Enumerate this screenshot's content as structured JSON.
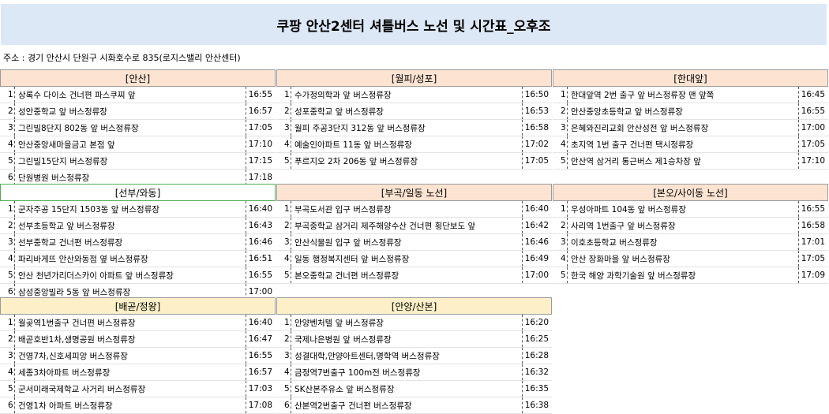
{
  "title": "쿠팡 안산2센터 셔틀버스 노선 및 시간표_오후조",
  "address": "주소 : 경기 안산시 단원구 시화호수로 835(로지스밸리 안산센터)",
  "routes": [
    {
      "name": "[안산]",
      "stops": [
        {
          "no": "1",
          "stop": "상록수 다이소 건너편 파스쿠찌 앞",
          "time": "16:55"
        },
        {
          "no": "2",
          "stop": "성안중학교 앞 버스정류장",
          "time": "16:57"
        },
        {
          "no": "3",
          "stop": "그린빌8단지 802동 앞 버스정류장",
          "time": "17:05"
        },
        {
          "no": "4",
          "stop": "안산중앙새마을금고 본점 앞",
          "time": "17:10"
        },
        {
          "no": "5",
          "stop": "그린빌15단지 버스정류장",
          "time": "17:15"
        },
        {
          "no": "6",
          "stop": "단원병원 버스정류장",
          "time": "17:18"
        }
      ]
    },
    {
      "name": "[월피/성포]",
      "stops": [
        {
          "no": "1",
          "stop": "수가정의학과 앞 버스정류장",
          "time": "16:50"
        },
        {
          "no": "2",
          "stop": "성포중학교 앞 버스정류장",
          "time": "16:53"
        },
        {
          "no": "3",
          "stop": "월피 주공3단지 312동 앞 버스정류장",
          "time": "16:58"
        },
        {
          "no": "4",
          "stop": "예술인아파트 11동 앞 버스정류장",
          "time": "17:02"
        },
        {
          "no": "5",
          "stop": "푸르지오 2차 206동 앞 버스정류장",
          "time": "17:05"
        }
      ]
    },
    {
      "name": "[한대앞]",
      "stops": [
        {
          "no": "1",
          "stop": "한대앞역 2번 출구 앞 버스정류장 맨 앞쪽",
          "time": "16:45"
        },
        {
          "no": "2",
          "stop": "안산중앙초등학교 앞 버스정류장",
          "time": "16:55"
        },
        {
          "no": "3",
          "stop": "은혜와진리교회 안산성전 앞 버스정류장",
          "time": "17:00"
        },
        {
          "no": "4",
          "stop": "초지역 1번 출구 건너편 택시정류장",
          "time": "17:05"
        },
        {
          "no": "5",
          "stop": "안산역 삼거리 통근버스 제1승차장 앞",
          "time": "17:10"
        }
      ]
    },
    {
      "name": "[선부/와동]",
      "stops": [
        {
          "no": "1",
          "stop": "군자주공 15단지 1503동 앞 버스정류장",
          "time": "16:40"
        },
        {
          "no": "2",
          "stop": "선부초등학교 앞 버스정류장",
          "time": "16:43"
        },
        {
          "no": "3",
          "stop": "선부중학교 건너편 버스정류장",
          "time": "16:46"
        },
        {
          "no": "4",
          "stop": "파리바게뜨 안산와동점 옆 버스정류장",
          "time": "16:51"
        },
        {
          "no": "5",
          "stop": "안산 천년가리더스카이 아파트 앞 버스정류장",
          "time": "16:55"
        },
        {
          "no": "6",
          "stop": "삼성중앙빌라 5동 앞 버스정류장",
          "time": "17:00"
        }
      ]
    },
    {
      "name": "[부곡/일동 노선]",
      "stops": [
        {
          "no": "1",
          "stop": "부곡도서관 입구 버스정류장",
          "time": "16:40"
        },
        {
          "no": "2",
          "stop": "부곡중학교 삼거리 제주해양수산 건너편 횡단보도 앞",
          "time": "16:42"
        },
        {
          "no": "3",
          "stop": "안산식물원 입구 앞 버스정류장",
          "time": "16:46"
        },
        {
          "no": "4",
          "stop": "일동 행정복지센터 앞 버스정류장",
          "time": "16:49"
        },
        {
          "no": "5",
          "stop": "본오중학교 건너편 버스정류장",
          "time": "17:00"
        }
      ]
    },
    {
      "name": "[본오/사이동 노선]",
      "stops": [
        {
          "no": "1",
          "stop": "우성아파트 104동 앞 버스정류장",
          "time": "16:55"
        },
        {
          "no": "2",
          "stop": "사리역 1번출구 앞 버스정류장",
          "time": "16:58"
        },
        {
          "no": "3",
          "stop": "이호초등학교 버스정류장",
          "time": "17:01"
        },
        {
          "no": "4",
          "stop": "안산 장화마을 앞 버스정류장",
          "time": "17:05"
        },
        {
          "no": "5",
          "stop": "한국 해양 과학기술원 앞 버스정류장",
          "time": "17:09"
        }
      ]
    },
    {
      "name": "[배곧/정왕]",
      "stops": [
        {
          "no": "1",
          "stop": "월곶역1번출구 건너편 버스정류장",
          "time": "16:40"
        },
        {
          "no": "2",
          "stop": "배곧호반1차,생명공원 버스정류장",
          "time": "16:47"
        },
        {
          "no": "3",
          "stop": "건영7차,신호세피앙 버스정류장",
          "time": "16:55"
        },
        {
          "no": "4",
          "stop": "세종3차아파트 버스정류장",
          "time": "16:57"
        },
        {
          "no": "5",
          "stop": "군서미래국제학교 사거리 버스정류장",
          "time": "17:03"
        },
        {
          "no": "6",
          "stop": "건영1차 아파트 버스정류장",
          "time": "17:08"
        }
      ]
    },
    {
      "name": "[안양/산본]",
      "stops": [
        {
          "no": "1",
          "stop": "안양벤처텔 앞 버스정류장",
          "time": "16:20"
        },
        {
          "no": "2",
          "stop": "국제나은병원 앞 버스정류장",
          "time": "16:25"
        },
        {
          "no": "3",
          "stop": "성결대학,안양아트센터,명학역 버스정류장",
          "time": "16:28"
        },
        {
          "no": "4",
          "stop": "금정역7번출구 100m전 버스정류장",
          "time": "16:32"
        },
        {
          "no": "5",
          "stop": "SK산본주유소 앞 버스정류장",
          "time": "16:35"
        },
        {
          "no": "6",
          "stop": "산본역2번출구 건너편 버스정류장",
          "time": "16:38"
        }
      ]
    }
  ]
}
